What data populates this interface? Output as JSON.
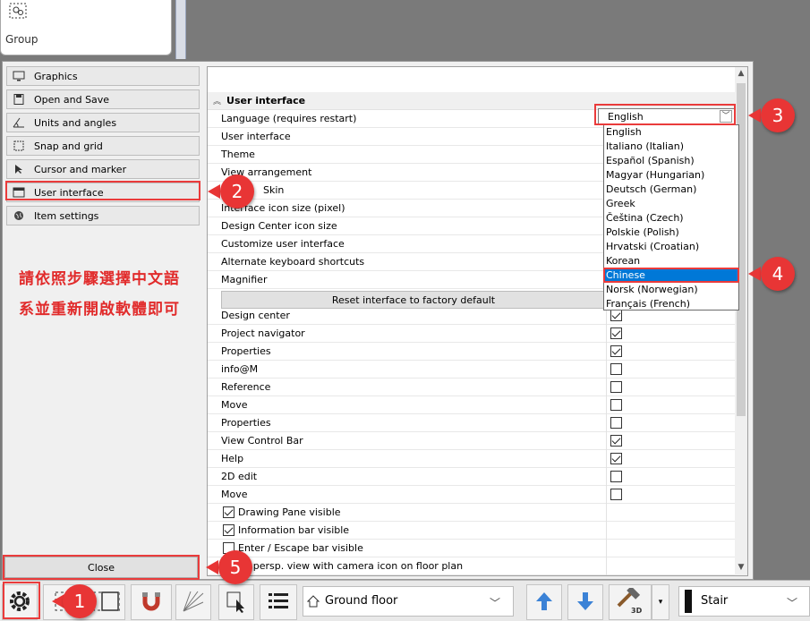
{
  "group_panel": {
    "label": "Group"
  },
  "nav": {
    "items": [
      {
        "label": "Graphics",
        "icon": "monitor-icon"
      },
      {
        "label": "Open and Save",
        "icon": "floppy-icon"
      },
      {
        "label": "Units and angles",
        "icon": "angle-icon"
      },
      {
        "label": "Snap and grid",
        "icon": "snap-grid-icon"
      },
      {
        "label": "Cursor and marker",
        "icon": "cursor-icon"
      },
      {
        "label": "User interface",
        "icon": "window-icon"
      },
      {
        "label": "Item settings",
        "icon": "globe-icon"
      }
    ],
    "close_label": "Close"
  },
  "annotation": {
    "line1": "請依照步驟選擇中文語",
    "line2": "系並重新開啟軟體即可"
  },
  "grid": {
    "section_title": "User interface",
    "rows": [
      {
        "name": "Language (requires restart)"
      },
      {
        "name": "User interface"
      },
      {
        "name": "Theme"
      },
      {
        "name": "View arrangement"
      },
      {
        "name": "Skin"
      },
      {
        "name": "Interface icon size (pixel)"
      },
      {
        "name": "Design Center icon size"
      },
      {
        "name": "Customize user interface"
      },
      {
        "name": "Alternate keyboard shortcuts"
      },
      {
        "name": "Magnifier"
      }
    ],
    "reset_label": "Reset interface to factory default",
    "check_rows": [
      {
        "name": "Design center",
        "checked": true
      },
      {
        "name": "Project navigator",
        "checked": true
      },
      {
        "name": "Properties",
        "checked": true
      },
      {
        "name": "info@M",
        "checked": false
      },
      {
        "name": "Reference",
        "checked": false
      },
      {
        "name": "Move",
        "checked": false
      },
      {
        "name": "Properties",
        "checked": false
      },
      {
        "name": "View Control Bar",
        "checked": true
      },
      {
        "name": "Help",
        "checked": true
      },
      {
        "name": "2D edit",
        "checked": false
      },
      {
        "name": "Move",
        "checked": false
      }
    ],
    "inline_checks": [
      {
        "name": "Drawing Pane visible",
        "checked": true
      },
      {
        "name": "Information bar visible",
        "checked": true
      },
      {
        "name": "Enter / Escape bar visible",
        "checked": false
      },
      {
        "name": "ay persp. view with camera icon on floor plan",
        "checked": false
      }
    ]
  },
  "language": {
    "selected": "English",
    "options": [
      "English",
      "Italiano (Italian)",
      "Español (Spanish)",
      "Magyar (Hungarian)",
      "Deutsch (German)",
      "Greek",
      "Čeština (Czech)",
      "Polskie (Polish)",
      "Hrvatski (Croatian)",
      "Korean",
      "Chinese",
      "Norsk (Norwegian)",
      "Français (French)"
    ],
    "highlighted": "Chinese"
  },
  "callouts": [
    "1",
    "2",
    "3",
    "4",
    "5"
  ],
  "toolbar": {
    "floor": "Ground floor",
    "stair": "Stair"
  },
  "colors": {
    "accent_red": "#e83535",
    "selection_blue": "#0078d7"
  }
}
